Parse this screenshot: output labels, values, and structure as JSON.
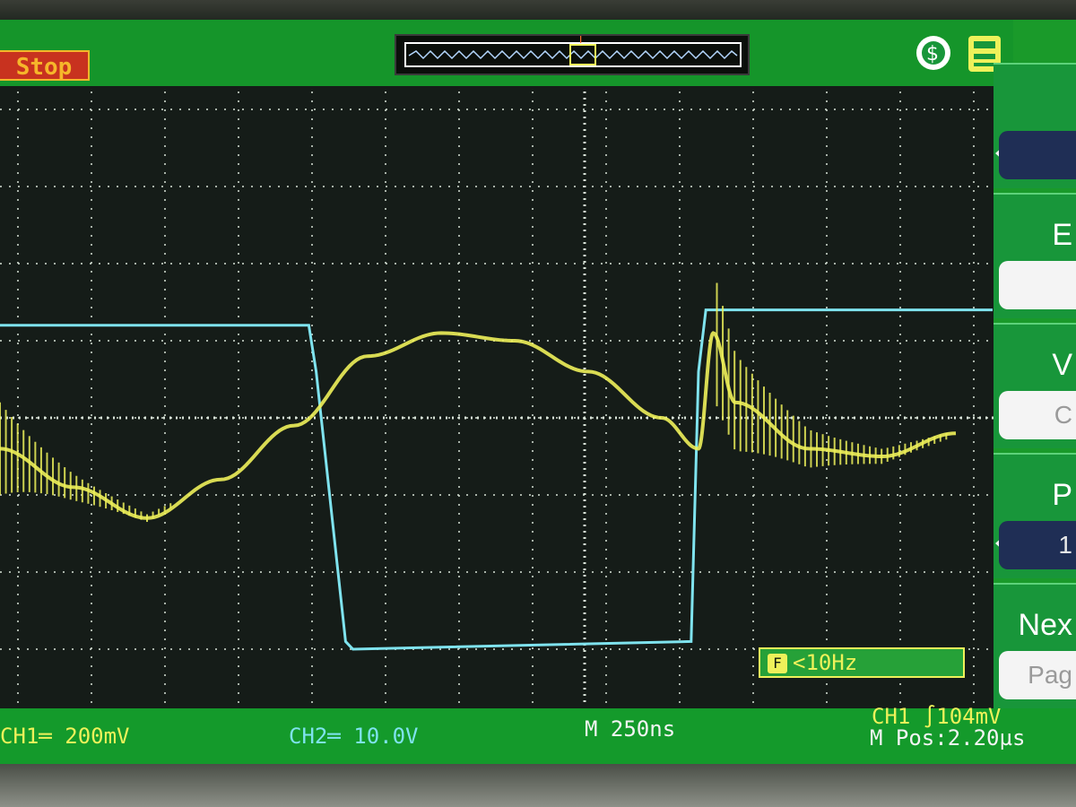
{
  "run_state": "Stop",
  "trigger_marker": "T",
  "timebase": "M 250ns",
  "ch1": {
    "label": "CH1",
    "coupling_symbol": "═",
    "scale": "CH1═ 200mV",
    "color": "#eef15a"
  },
  "ch2": {
    "label": "CH2",
    "scale": "CH2═ 10.0V",
    "color": "#7fe3ee"
  },
  "trigger": {
    "readout": "CH1 ∫104mV"
  },
  "position": "M Pos:2.20µs",
  "frequency_readout": "<10Hz",
  "frequency_icon": "counter-icon",
  "menu": [
    {
      "label": "",
      "value": "",
      "style": "dark"
    },
    {
      "label": "E",
      "value": "",
      "style": "light"
    },
    {
      "label": "V",
      "value": "C",
      "style": "light"
    },
    {
      "label": "P",
      "value": "1",
      "style": "dark"
    },
    {
      "label": "Nex",
      "value": "Pag",
      "style": "light"
    }
  ],
  "colors": {
    "screen_green": "#1a9a2a",
    "graticule": "#d9e4d9",
    "stop_red": "#c8321f"
  },
  "chart_data": {
    "type": "line",
    "x_divisions": 14,
    "y_divisions": 8,
    "x_unit": "div (250ns/div)",
    "series": [
      {
        "name": "CH2",
        "x": [
          0,
          4.2,
          4.3,
          4.7,
          4.8,
          9.4,
          9.5,
          9.6,
          13.5
        ],
        "y": [
          1.2,
          1.2,
          0.6,
          -2.9,
          -3.0,
          -2.9,
          0.6,
          1.4,
          1.4
        ]
      },
      {
        "name": "CH1",
        "x": [
          0,
          1,
          2,
          3,
          4,
          5,
          6,
          7,
          8,
          9,
          9.5,
          9.7,
          10,
          11,
          12,
          13
        ],
        "y": [
          -0.4,
          -0.9,
          -1.3,
          -0.8,
          -0.1,
          0.8,
          1.1,
          1.0,
          0.6,
          0.0,
          -0.4,
          1.1,
          0.2,
          -0.4,
          -0.5,
          -0.2
        ]
      }
    ]
  }
}
